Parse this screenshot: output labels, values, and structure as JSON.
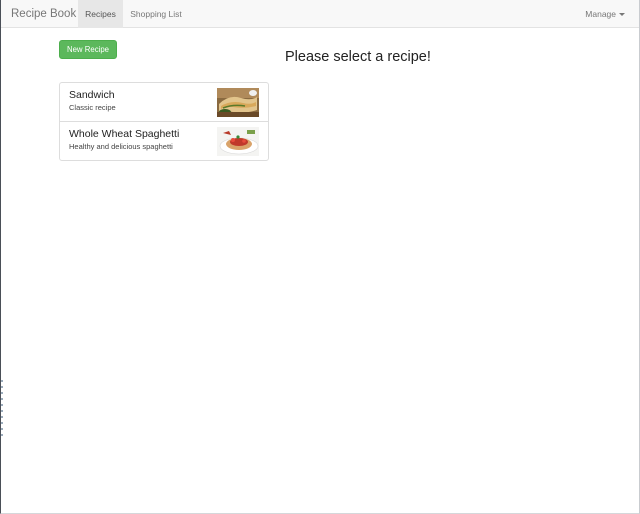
{
  "navbar": {
    "brand": "Recipe Book",
    "tabs": [
      {
        "label": "Recipes",
        "active": true
      },
      {
        "label": "Shopping List",
        "active": false
      }
    ],
    "manage_label": "Manage"
  },
  "recipes_panel": {
    "new_button_label": "New Recipe",
    "items": [
      {
        "name": "Sandwich",
        "description": "Classic recipe",
        "image_icon": "sandwich-image"
      },
      {
        "name": "Whole Wheat Spaghetti",
        "description": "Healthy and delicious spaghetti",
        "image_icon": "spaghetti-image"
      }
    ]
  },
  "main": {
    "placeholder_heading": "Please select a recipe!"
  },
  "colors": {
    "success_green": "#5cb85c",
    "navbar_bg": "#f8f8f8",
    "active_tab_bg": "#e7e7e7"
  }
}
